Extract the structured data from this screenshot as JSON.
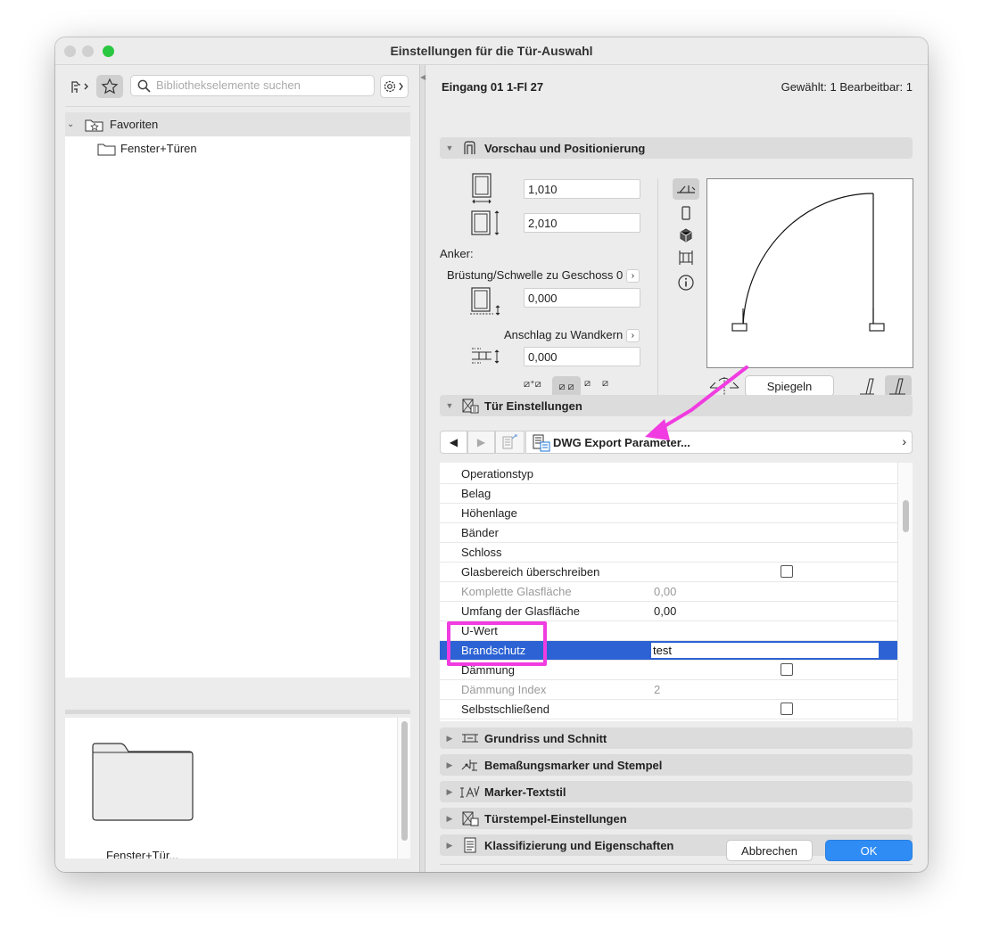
{
  "window": {
    "title": "Einstellungen für die Tür-Auswahl"
  },
  "left": {
    "search_placeholder": "Bibliothekselemente suchen",
    "tree": [
      {
        "label": "Favoriten"
      },
      {
        "label": "Fenster+Türen"
      }
    ],
    "preview_caption": "Fenster+Tür..."
  },
  "right": {
    "header_left": "Eingang 01 1-Fl 27",
    "header_right": "Gewählt: 1 Bearbeitbar: 1",
    "section_preview": "Vorschau und Positionierung",
    "width_value": "1,010",
    "height_value": "2,010",
    "anker_label": "Anker:",
    "bruestung_label": "Brüstung/Schwelle zu Geschoss 0",
    "bruestung_value": "0,000",
    "anschlag_label": "Anschlag zu Wandkern",
    "anschlag_value": "0,000",
    "spiegeln_label": "Spiegeln",
    "section_door": "Tür Einstellungen",
    "dwg_label": "DWG Export Parameter...",
    "params": [
      {
        "name": "Operationstyp",
        "value": "",
        "checkbox": false,
        "dim": false,
        "selected": false
      },
      {
        "name": "Belag",
        "value": "",
        "checkbox": false,
        "dim": false,
        "selected": false
      },
      {
        "name": "Höhenlage",
        "value": "",
        "checkbox": false,
        "dim": false,
        "selected": false
      },
      {
        "name": "Bänder",
        "value": "",
        "checkbox": false,
        "dim": false,
        "selected": false
      },
      {
        "name": "Schloss",
        "value": "",
        "checkbox": false,
        "dim": false,
        "selected": false
      },
      {
        "name": "Glasbereich überschreiben",
        "value": "",
        "checkbox": true,
        "dim": false,
        "selected": false
      },
      {
        "name": "Komplette Glasfläche",
        "value": "0,00",
        "checkbox": false,
        "dim": true,
        "selected": false
      },
      {
        "name": "Umfang der Glasfläche",
        "value": "0,00",
        "checkbox": false,
        "dim": false,
        "selected": false
      },
      {
        "name": "U-Wert",
        "value": "",
        "checkbox": false,
        "dim": false,
        "selected": false
      },
      {
        "name": "Brandschutz",
        "value": "test",
        "checkbox": false,
        "dim": false,
        "selected": true
      },
      {
        "name": "Dämmung",
        "value": "",
        "checkbox": true,
        "dim": false,
        "selected": false
      },
      {
        "name": "Dämmung Index",
        "value": "2",
        "checkbox": false,
        "dim": true,
        "selected": false
      },
      {
        "name": "Selbstschließend",
        "value": "",
        "checkbox": true,
        "dim": false,
        "selected": false
      }
    ],
    "collapsed_sections": [
      {
        "label": "Grundriss und Schnitt",
        "icon": "floorplan-icon"
      },
      {
        "label": "Bemaßungsmarker und Stempel",
        "icon": "dimension-marker-icon"
      },
      {
        "label": "Marker-Textstil",
        "icon": "text-style-icon"
      },
      {
        "label": "Türstempel-Einstellungen",
        "icon": "door-stamp-icon"
      },
      {
        "label": "Klassifizierung und Eigenschaften",
        "icon": "classification-icon"
      }
    ],
    "cancel_label": "Abbrechen",
    "ok_label": "OK"
  },
  "colors": {
    "selection": "#2c62d4",
    "ok_button": "#2f8cf5",
    "annotation": "#f03ce0"
  }
}
